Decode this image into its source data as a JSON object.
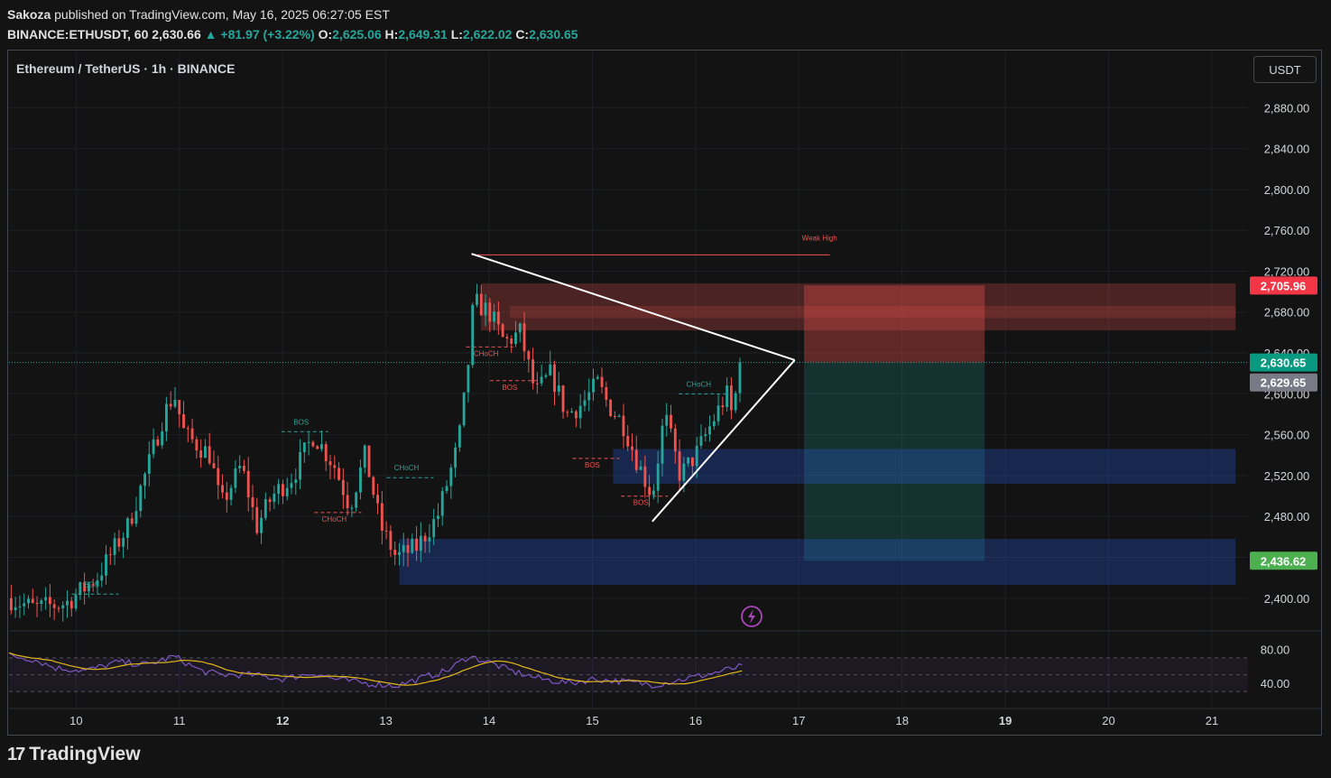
{
  "header": {
    "author": "Sakoza",
    "published_text": "published on TradingView.com, May 16, 2025 06:27:05 EST",
    "ticker": "BINANCE:ETHUSDT, 60",
    "last": "2,630.66",
    "change": "+81.97 (+3.22%)",
    "o_label": "O:",
    "o": "2,625.06",
    "h_label": "H:",
    "h": "2,649.31",
    "l_label": "L:",
    "l": "2,622.02",
    "c_label": "C:",
    "c": "2,630.65"
  },
  "symbol_title": "Ethereum / TetherUS · 1h · BINANCE",
  "currency_button": "USDT",
  "brand": "TradingView",
  "colors": {
    "up": "#26a69a",
    "down": "#ef5350",
    "background": "#131313",
    "rsi_line": "#7e57c2",
    "rsi_ma": "#e4b719",
    "stop_zone": "#ef5350",
    "target_zone": "#26a69a",
    "demand_zone": "#2962ff"
  },
  "chart_data": {
    "type": "candlestick",
    "title": "Ethereum / TetherUS · 1h · BINANCE",
    "x_tick_labels": [
      "10",
      "11",
      "12",
      "13",
      "14",
      "15",
      "16",
      "17",
      "18",
      "19",
      "20",
      "21"
    ],
    "y_tick_labels": [
      "2,880.00",
      "2,840.00",
      "2,800.00",
      "2,760.00",
      "2,720.00",
      "2,680.00",
      "2,640.00",
      "2,600.00",
      "2,560.00",
      "2,520.00",
      "2,480.00",
      "2,440.00",
      "2,400.00"
    ],
    "y_ticks": [
      2880,
      2840,
      2800,
      2760,
      2720,
      2680,
      2640,
      2600,
      2560,
      2520,
      2480,
      2440,
      2400
    ],
    "ylim": [
      2368,
      2935
    ],
    "xlim": [
      9.35,
      21.35
    ],
    "grid": true,
    "anchors": [
      [
        9.35,
        2400
      ],
      [
        9.6,
        2390
      ],
      [
        9.9,
        2395
      ],
      [
        10.2,
        2420
      ],
      [
        10.5,
        2470
      ],
      [
        10.7,
        2530
      ],
      [
        10.85,
        2580
      ],
      [
        10.95,
        2600
      ],
      [
        11.05,
        2560
      ],
      [
        11.3,
        2540
      ],
      [
        11.4,
        2490
      ],
      [
        11.6,
        2530
      ],
      [
        11.75,
        2470
      ],
      [
        11.9,
        2500
      ],
      [
        12.1,
        2520
      ],
      [
        12.3,
        2560
      ],
      [
        12.5,
        2530
      ],
      [
        12.65,
        2490
      ],
      [
        12.8,
        2540
      ],
      [
        12.95,
        2470
      ],
      [
        13.1,
        2440
      ],
      [
        13.3,
        2450
      ],
      [
        13.5,
        2480
      ],
      [
        13.7,
        2550
      ],
      [
        13.78,
        2610
      ],
      [
        13.85,
        2690
      ],
      [
        14.0,
        2680
      ],
      [
        14.15,
        2650
      ],
      [
        14.3,
        2660
      ],
      [
        14.45,
        2600
      ],
      [
        14.6,
        2620
      ],
      [
        14.75,
        2580
      ],
      [
        14.9,
        2590
      ],
      [
        15.05,
        2610
      ],
      [
        15.15,
        2590
      ],
      [
        15.3,
        2570
      ],
      [
        15.45,
        2530
      ],
      [
        15.58,
        2500
      ],
      [
        15.7,
        2580
      ],
      [
        15.85,
        2520
      ],
      [
        16.0,
        2540
      ],
      [
        16.15,
        2570
      ],
      [
        16.3,
        2600
      ],
      [
        16.35,
        2580
      ],
      [
        16.45,
        2631
      ]
    ],
    "candle_count": 170,
    "last_price": 2630.65,
    "price_labels": [
      {
        "text": "2,705.96",
        "value": 2705.96,
        "color": "#f23645"
      },
      {
        "text": "2,630.65",
        "value": 2630.65,
        "color": "#089981"
      },
      {
        "text": "2,629.65",
        "value": 2629.65,
        "color": "#787b86"
      },
      {
        "text": "2,436.62",
        "value": 2436.62,
        "color": "#4caf50"
      }
    ],
    "annotations": [
      {
        "text": "Weak High",
        "x": 17.2,
        "y": 2750,
        "color": "#ef5350"
      },
      {
        "text": "BOS",
        "x": 10.15,
        "y": 2411,
        "color": "#26a69a"
      },
      {
        "text": "BOS",
        "x": 12.18,
        "y": 2570,
        "color": "#26a69a"
      },
      {
        "text": "CHoCH",
        "x": 12.5,
        "y": 2475,
        "color": "#ef5350"
      },
      {
        "text": "CHoCH",
        "x": 13.2,
        "y": 2525,
        "color": "#26a69a"
      },
      {
        "text": "CHoCH",
        "x": 13.97,
        "y": 2637,
        "color": "#ef5350"
      },
      {
        "text": "BOS",
        "x": 14.2,
        "y": 2604,
        "color": "#ef5350"
      },
      {
        "text": "BOS",
        "x": 15.0,
        "y": 2528,
        "color": "#ef5350"
      },
      {
        "text": "BOS",
        "x": 15.47,
        "y": 2491,
        "color": "#ef5350"
      },
      {
        "text": "CHoCH",
        "x": 16.03,
        "y": 2607,
        "color": "#26a69a"
      }
    ],
    "zones": [
      {
        "kind": "supply",
        "x0": 13.92,
        "x1": 21.23,
        "y0": 2662,
        "y1": 2708,
        "color": "#ef5350"
      },
      {
        "kind": "supply-inner",
        "x0": 14.2,
        "x1": 21.23,
        "y0": 2674,
        "y1": 2686,
        "color": "#ef5350"
      },
      {
        "kind": "stop",
        "x0": 17.05,
        "x1": 18.8,
        "y0": 2630.65,
        "y1": 2705.96,
        "color": "#ef5350"
      },
      {
        "kind": "target",
        "x0": 17.05,
        "x1": 18.8,
        "y0": 2436.62,
        "y1": 2630.65,
        "color": "#26a69a"
      },
      {
        "kind": "demand",
        "x0": 15.2,
        "x1": 21.23,
        "y0": 2512,
        "y1": 2546,
        "color": "#2962ff"
      },
      {
        "kind": "demand",
        "x0": 13.13,
        "x1": 21.23,
        "y0": 2413,
        "y1": 2458,
        "color": "#2962ff"
      }
    ],
    "trendlines": [
      {
        "x0": 13.83,
        "y0": 2737,
        "x1": 16.96,
        "y1": 2633,
        "color": "#ffffff"
      },
      {
        "x0": 15.58,
        "y0": 2475,
        "x1": 16.96,
        "y1": 2633,
        "color": "#ffffff"
      }
    ],
    "weak_high": {
      "x0": 13.83,
      "x1": 17.3,
      "y": 2736,
      "color": "#ef5350"
    },
    "rsi": {
      "y_tick_labels": [
        "80.00",
        "40.00"
      ],
      "y_ticks": [
        80,
        40
      ],
      "ylim": [
        10,
        102
      ],
      "band": [
        30,
        70
      ],
      "anchors": [
        [
          9.35,
          73
        ],
        [
          9.6,
          68
        ],
        [
          9.8,
          58
        ],
        [
          10.1,
          55
        ],
        [
          10.4,
          65
        ],
        [
          10.7,
          62
        ],
        [
          10.95,
          72
        ],
        [
          11.2,
          55
        ],
        [
          11.4,
          50
        ],
        [
          11.7,
          50
        ],
        [
          12.0,
          45
        ],
        [
          12.3,
          52
        ],
        [
          12.5,
          45
        ],
        [
          12.8,
          40
        ],
        [
          13.1,
          37
        ],
        [
          13.4,
          48
        ],
        [
          13.6,
          55
        ],
        [
          13.8,
          72
        ],
        [
          14.0,
          65
        ],
        [
          14.2,
          55
        ],
        [
          14.5,
          45
        ],
        [
          14.8,
          40
        ],
        [
          15.0,
          45
        ],
        [
          15.3,
          42
        ],
        [
          15.6,
          38
        ],
        [
          15.8,
          43
        ],
        [
          16.1,
          50
        ],
        [
          16.45,
          60
        ]
      ]
    }
  }
}
